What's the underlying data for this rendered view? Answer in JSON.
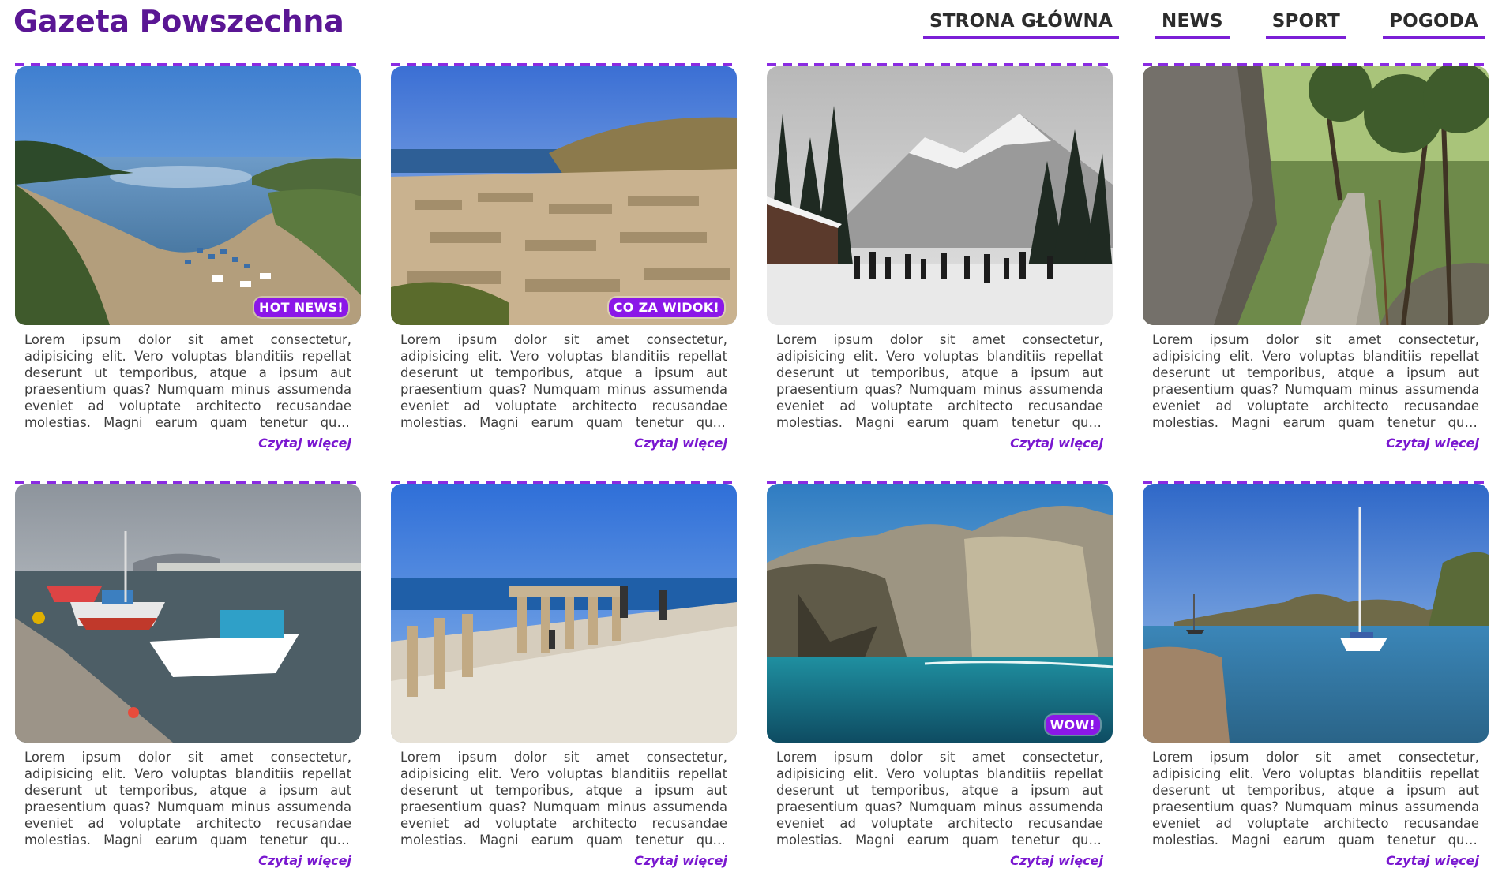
{
  "site": {
    "title": "Gazeta Powszechna"
  },
  "nav": {
    "items": [
      {
        "label": "STRONA GŁÓWNA"
      },
      {
        "label": "NEWS"
      },
      {
        "label": "SPORT"
      },
      {
        "label": "POGODA"
      }
    ]
  },
  "colors": {
    "brand": "#5a1694",
    "accent": "#8b17e8",
    "link": "#7a18d0"
  },
  "articles": [
    {
      "image": "coastal-bay-photo",
      "badge": "HOT NEWS!",
      "text": "Lorem ipsum dolor sit amet consectetur, adipisicing elit. Vero voluptas blanditiis repellat deserunt ut temporibus, atque a ipsum aut praesentium quas? Numquam minus assumenda eveniet ad voluptate architecto recusandae molestias. Magni earum quam tenetur quos laborum eos saepe veniam.",
      "more": "Czytaj więcej"
    },
    {
      "image": "ancient-ruins-photo",
      "badge": "CO ZA WIDOK!",
      "text": "Lorem ipsum dolor sit amet consectetur, adipisicing elit. Vero voluptas blanditiis repellat deserunt ut temporibus, atque a ipsum aut praesentium quas? Numquam minus assumenda eveniet ad voluptate architecto recusandae molestias. Magni earum quam tenetur quos laborum eos saepe veniam.",
      "more": "Czytaj więcej"
    },
    {
      "image": "snowy-mountain-photo",
      "badge": "",
      "text": "Lorem ipsum dolor sit amet consectetur, adipisicing elit. Vero voluptas blanditiis repellat deserunt ut temporibus, atque a ipsum aut praesentium quas? Numquam minus assumenda eveniet ad voluptate architecto recusandae molestias. Magni earum quam tenetur quos laborum eos saepe veniam.",
      "more": "Czytaj więcej"
    },
    {
      "image": "forest-path-photo",
      "badge": "",
      "text": "Lorem ipsum dolor sit amet consectetur, adipisicing elit. Vero voluptas blanditiis repellat deserunt ut temporibus, atque a ipsum aut praesentium quas? Numquam minus assumenda eveniet ad voluptate architecto recusandae molestias. Magni earum quam tenetur quos laborum eos saepe veniam.",
      "more": "Czytaj więcej"
    },
    {
      "image": "fishing-boats-photo",
      "badge": "",
      "text": "Lorem ipsum dolor sit amet consectetur, adipisicing elit. Vero voluptas blanditiis repellat deserunt ut temporibus, atque a ipsum aut praesentium quas? Numquam minus assumenda eveniet ad voluptate architecto recusandae molestias. Magni earum quam tenetur quos laborum eos saepe veniam.",
      "more": "Czytaj więcej"
    },
    {
      "image": "acropolis-columns-photo",
      "badge": "",
      "text": "Lorem ipsum dolor sit amet consectetur, adipisicing elit. Vero voluptas blanditiis repellat deserunt ut temporibus, atque a ipsum aut praesentium quas? Numquam minus assumenda eveniet ad voluptate architecto recusandae molestias. Magni earum quam tenetur quos laborum eos saepe veniam.",
      "more": "Czytaj więcej"
    },
    {
      "image": "sea-cliff-photo",
      "badge": "WOW!",
      "text": "Lorem ipsum dolor sit amet consectetur, adipisicing elit. Vero voluptas blanditiis repellat deserunt ut temporibus, atque a ipsum aut praesentium quas? Numquam minus assumenda eveniet ad voluptate architecto recusandae molestias. Magni earum quam tenetur quos laborum eos saepe veniam.",
      "more": "Czytaj więcej"
    },
    {
      "image": "sailboat-bay-photo",
      "badge": "",
      "text": "Lorem ipsum dolor sit amet consectetur, adipisicing elit. Vero voluptas blanditiis repellat deserunt ut temporibus, atque a ipsum aut praesentium quas? Numquam minus assumenda eveniet ad voluptate architecto recusandae molestias. Magni earum quam tenetur quos laborum eos saepe veniam.",
      "more": "Czytaj więcej"
    }
  ]
}
